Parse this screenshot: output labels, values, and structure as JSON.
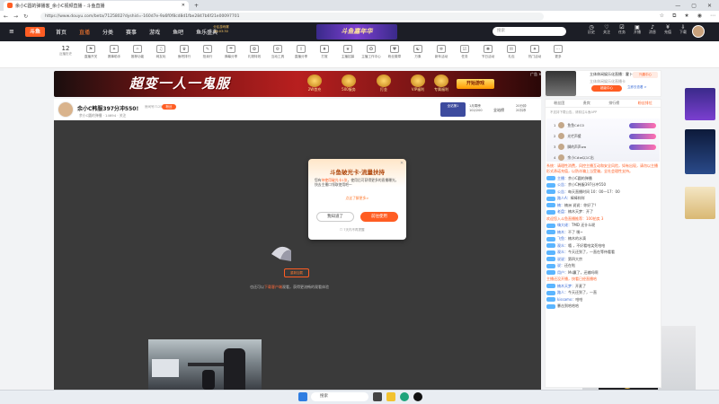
{
  "browser": {
    "tab_title": "余小C圆的弹播客_余小C视频直播 - 斗鱼直播",
    "url": "https://www.douyu.com/beta/7125802?dyshid=-160d7e-9a6f0f8cd8d1fbe2847b6f21e00097701",
    "controls": {
      "min": "—",
      "max": "▢",
      "close": "✕"
    }
  },
  "nav": {
    "logo": "斗鱼",
    "links": [
      "首页",
      "直播",
      "分类",
      "赛事",
      "游戏",
      "鱼吧",
      "鱼乐盛典"
    ],
    "active": "直播",
    "promo": "分区游戏赛 16:03:30",
    "banner": "斗鱼嘉年华",
    "search_placeholder": "搜索",
    "icons": [
      "历史",
      "关注",
      "任务",
      "开播",
      "消息",
      "充值",
      "下载",
      "翻译"
    ]
  },
  "categories": {
    "history_count": "12",
    "history_label": "近播历史",
    "items": [
      "直播开关",
      "赛事助手",
      "推荐功能",
      "网友玩",
      "鱼吧排行",
      "拍卖行",
      "弹幕分享",
      "礼物特效",
      "互动工具",
      "直播分享",
      "打赏",
      "主播招募",
      "主播工作中心",
      "粉丝徽章",
      "万象",
      "新年活动",
      "任务",
      "节日活动",
      "礼包",
      "热门活动",
      "更多"
    ]
  },
  "ad": {
    "title": "超变一人一鬼服",
    "icons": [
      "2W首充",
      "500服务",
      "打金",
      "VIP福利",
      "专属福利"
    ],
    "button": "开始游戏",
    "close": "广告 ✕"
  },
  "side_ad": {
    "line1": "立体休闲娱乐化直播：霍卜空",
    "line2": "立体休闲娱乐化直播卡",
    "button": "超级中心",
    "tag": "兴趣中心",
    "sub": "立即去查看 >"
  },
  "room": {
    "title": "余小C韩服397分冲550!",
    "room_id": "房间号7125802",
    "tag": "粉丝",
    "meta": "余小C圆的弹播 · 14694 · 关注",
    "fans_label": "全站第1",
    "rank_label": "1月周榜",
    "rank_value": "102/200",
    "weekly": "全站榜",
    "gift_label": "20分钟",
    "gift_value": "20抖币"
  },
  "player": {
    "retry": "重新加载",
    "tip_prefix": "也还可以",
    "tip_link": "下载客户端",
    "tip_suffix": "观看，获得更流畅的观看体验"
  },
  "modal": {
    "title": "斗鱼破光卡·流量扶持",
    "body_prefix": "您有",
    "body_highlight": "待使用破光卡1张",
    "body_suffix": "，使用后可获得更多的直播曝光，快去主播口领取使用吧～",
    "link": "点这了解更多>",
    "cancel": "我知道了",
    "confirm": "前往使用",
    "checkbox": "7天内不再提醒",
    "close": "✕"
  },
  "panel": {
    "tabs": [
      "粉丝团",
      "贵宾",
      "排行榜",
      "粉丝排位"
    ],
    "active_tab": "粉丝排位",
    "notice": "不支持下载公告，请前往斗鱼APP",
    "rank": [
      {
        "name": "鱼鱼C#C0",
        "pos": "1"
      },
      {
        "name": "光栏声援",
        "pos": "2"
      },
      {
        "name": "脚的声声wa",
        "pos": "3"
      },
      {
        "name": "余小C#w以1C出",
        "pos": "4"
      }
    ]
  },
  "chat": [
    {
      "type": "sys",
      "text": "系统：请理性消费，风控主播互动和安全风险，如有出现，请勿以主播形式承诺充值，以防诈骗上当受骗，全社会理性支持。"
    },
    {
      "type": "msg",
      "name": "主播：",
      "text": "余小C圆的弹播"
    },
    {
      "type": "msg",
      "name": "公告：",
      "text": "余小C韩服397分冲550"
    },
    {
      "type": "msg",
      "name": "公告：",
      "text": "每天直播时间 10：00—17：00"
    },
    {
      "type": "msg",
      "name": "路人A：",
      "text": "棒棒样样"
    },
    {
      "type": "msg",
      "name": "楠：",
      "text": "楠洲 说说：你好了？"
    },
    {
      "type": "msg",
      "name": "老盘：",
      "text": "楠木天梦：开了"
    },
    {
      "type": "sys",
      "text": "欢迎您入斗鱼直播推荐：100拍卖 3"
    },
    {
      "type": "msg",
      "name": "嗨大佬：",
      "text": "TMD 还什么呢"
    },
    {
      "type": "msg",
      "name": "楠木：",
      "text": "不了 嘿~"
    },
    {
      "type": "msg",
      "name": "飞鱼：",
      "text": "楠木的水滴"
    },
    {
      "type": "msg",
      "name": "观众：",
      "text": "嘻 ，不好看哈笑死哈哈"
    },
    {
      "type": "msg",
      "name": "观众：",
      "text": "今天还到了，一直在等待看看"
    },
    {
      "type": "msg",
      "name": "说说：",
      "text": "第四大宗"
    },
    {
      "type": "msg",
      "name": "说：",
      "text": "还在啦"
    },
    {
      "type": "msg",
      "name": "用户：",
      "text": "Ms赢了，还输吗啊"
    },
    {
      "type": "sys",
      "text": "主播还没开播，快看已经直播哈"
    },
    {
      "type": "msg",
      "name": "楠木天梦：",
      "text": "开麦了"
    },
    {
      "type": "msg",
      "name": "路人：",
      "text": "今天还到了，一直"
    },
    {
      "type": "msg",
      "name": "kissamo：",
      "text": "哈哈"
    },
    {
      "type": "msg",
      "name": "",
      "text": "暴击到哈哈哈"
    }
  ],
  "taskbar": {
    "search": "搜索"
  }
}
